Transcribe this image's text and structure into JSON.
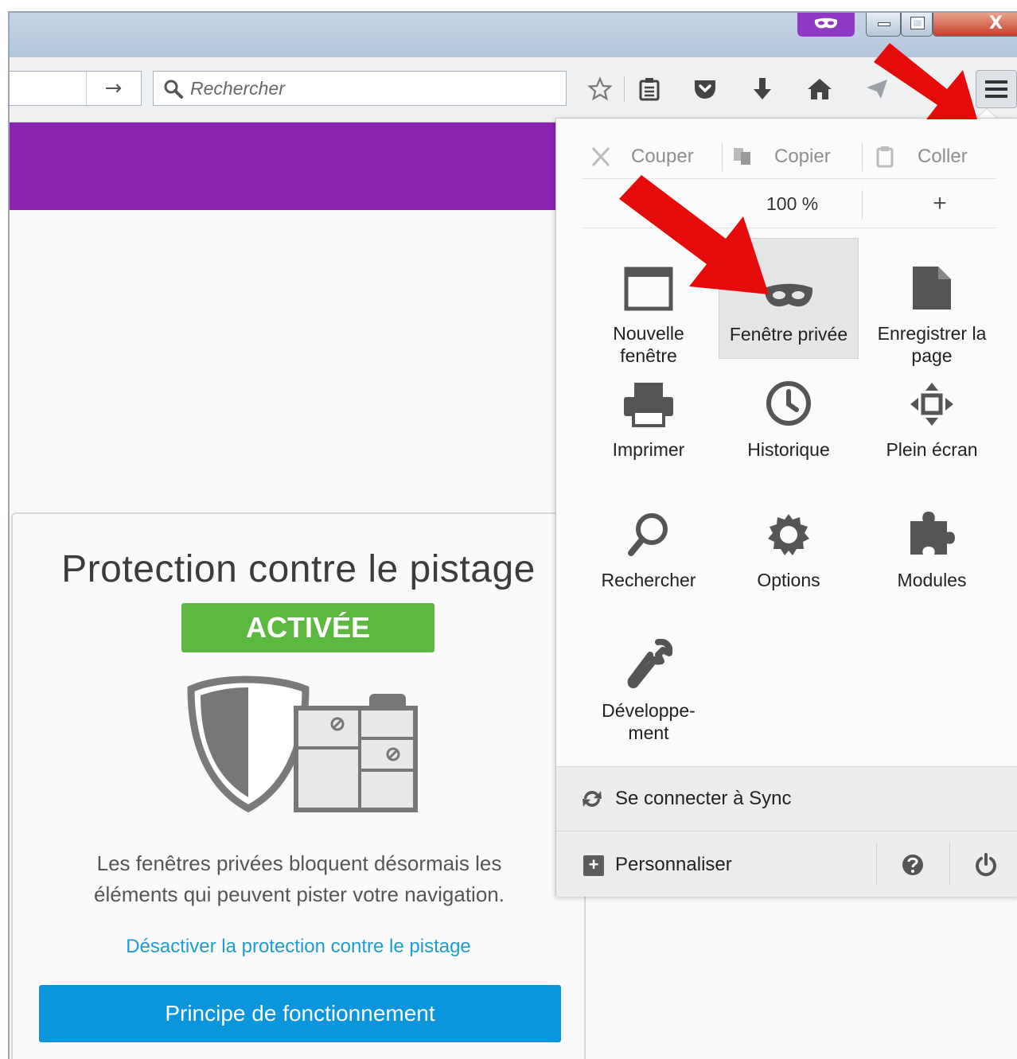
{
  "window": {
    "private_badge_icon": "mask-icon",
    "minimize_icon": "minimize-icon",
    "maximize_icon": "maximize-icon",
    "close_label": "X"
  },
  "toolbar": {
    "go_label": "→",
    "search_placeholder": "Rechercher",
    "icons": [
      "star-icon",
      "reading-list-icon",
      "pocket-icon",
      "download-icon",
      "home-icon",
      "send-icon",
      "menu-icon"
    ]
  },
  "tracking": {
    "title": "Protection contre le pistage",
    "status": "ACTIVÉE",
    "description_line1": "Les fenêtres privées bloquent désormais les",
    "description_line2": "éléments qui peuvent pister votre navigation.",
    "disable_link": "Désactiver la protection contre le pistage",
    "learn_button": "Principe de fonctionnement"
  },
  "menu": {
    "edit": {
      "cut": "Couper",
      "copy": "Copier",
      "paste": "Coller"
    },
    "zoom": {
      "value": "100 %",
      "plus": "+"
    },
    "items": [
      {
        "label_1": "Nouvelle",
        "label_2": "fenêtre",
        "icon": "new-window-icon"
      },
      {
        "label_1": "Fenêtre privée",
        "label_2": "",
        "icon": "private-window-icon"
      },
      {
        "label_1": "Enregistrer la",
        "label_2": "page",
        "icon": "save-page-icon"
      },
      {
        "label_1": "Imprimer",
        "label_2": "",
        "icon": "print-icon"
      },
      {
        "label_1": "Historique",
        "label_2": "",
        "icon": "history-icon"
      },
      {
        "label_1": "Plein écran",
        "label_2": "",
        "icon": "fullscreen-icon"
      },
      {
        "label_1": "Rechercher",
        "label_2": "",
        "icon": "search-icon"
      },
      {
        "label_1": "Options",
        "label_2": "",
        "icon": "options-gear-icon"
      },
      {
        "label_1": "Modules",
        "label_2": "",
        "icon": "puzzle-icon"
      },
      {
        "label_1": "Développe-",
        "label_2": "ment",
        "icon": "wrench-icon"
      }
    ],
    "sync": "Se connecter à Sync",
    "customize": "Personnaliser"
  },
  "colors": {
    "private_purple": "#8a23af",
    "activated_green": "#5cb83e",
    "primary_blue": "#0a95dd",
    "link_blue": "#1f9bd1",
    "annotation_red": "#e50b0b"
  }
}
